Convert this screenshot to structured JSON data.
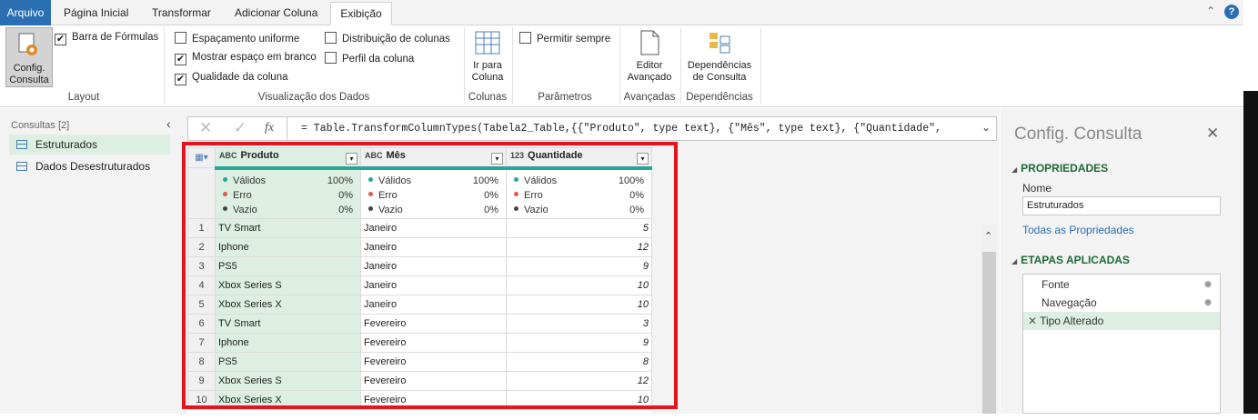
{
  "tabs": {
    "file": "Arquivo",
    "home": "Página Inicial",
    "transform": "Transformar",
    "add_column": "Adicionar Coluna",
    "view": "Exibição"
  },
  "ribbon": {
    "layout": {
      "config_btn": "Config.\nConsulta",
      "formula_bar": "Barra de Fórmulas",
      "group": "Layout"
    },
    "data_view": {
      "monospace": "Espaçamento uniforme",
      "whitespace": "Mostrar espaço em branco",
      "column_quality": "Qualidade da coluna",
      "column_distribution": "Distribuição de colunas",
      "column_profile": "Perfil da coluna",
      "group": "Visualização dos Dados"
    },
    "columns": {
      "goto": "Ir para\nColuna",
      "group": "Colunas"
    },
    "params": {
      "always_allow": "Permitir sempre",
      "group": "Parâmetros"
    },
    "advanced": {
      "editor": "Editor\nAvançado",
      "group": "Avançadas"
    },
    "dependencies": {
      "btn": "Dependências\nde Consulta",
      "group": "Dependências"
    }
  },
  "queries": {
    "header": "Consultas [2]",
    "items": [
      "Estruturados",
      "Dados Desestruturados"
    ]
  },
  "formula": {
    "fx": "fx",
    "text": "= Table.TransformColumnTypes(Tabela2_Table,{{\"Produto\", type text}, {\"Mês\", type text}, {\"Quantidade\","
  },
  "columns": [
    {
      "type": "ABC",
      "name": "Produto",
      "valid": "100%",
      "error": "0%",
      "empty": "0%"
    },
    {
      "type": "ABC",
      "name": "Mês",
      "valid": "100%",
      "error": "0%",
      "empty": "0%"
    },
    {
      "type": "123",
      "name": "Quantidade",
      "valid": "100%",
      "error": "0%",
      "empty": "0%"
    }
  ],
  "quality_labels": {
    "valid": "Válidos",
    "error": "Erro",
    "empty": "Vazio"
  },
  "rows": [
    [
      "1",
      "TV Smart",
      "Janeiro",
      "5"
    ],
    [
      "2",
      "Iphone",
      "Janeiro",
      "12"
    ],
    [
      "3",
      "PS5",
      "Janeiro",
      "9"
    ],
    [
      "4",
      "Xbox Series S",
      "Janeiro",
      "10"
    ],
    [
      "5",
      "Xbox Series X",
      "Janeiro",
      "10"
    ],
    [
      "6",
      "TV Smart",
      "Fevereiro",
      "3"
    ],
    [
      "7",
      "Iphone",
      "Fevereiro",
      "9"
    ],
    [
      "8",
      "PS5",
      "Fevereiro",
      "8"
    ],
    [
      "9",
      "Xbox Series S",
      "Fevereiro",
      "12"
    ],
    [
      "10",
      "Xbox Series X",
      "Fevereiro",
      "10"
    ]
  ],
  "settings": {
    "title": "Config. Consulta",
    "properties": "PROPRIEDADES",
    "name_label": "Nome",
    "name_value": "Estruturados",
    "all_props": "Todas as Propriedades",
    "steps_header": "ETAPAS APLICADAS",
    "steps": [
      "Fonte",
      "Navegação",
      "Tipo Alterado"
    ]
  },
  "colors": {
    "accent": "#2b6fb3",
    "selected": "#dcefe2",
    "quality_bar": "#26a69a",
    "highlight": "#e3141e"
  }
}
